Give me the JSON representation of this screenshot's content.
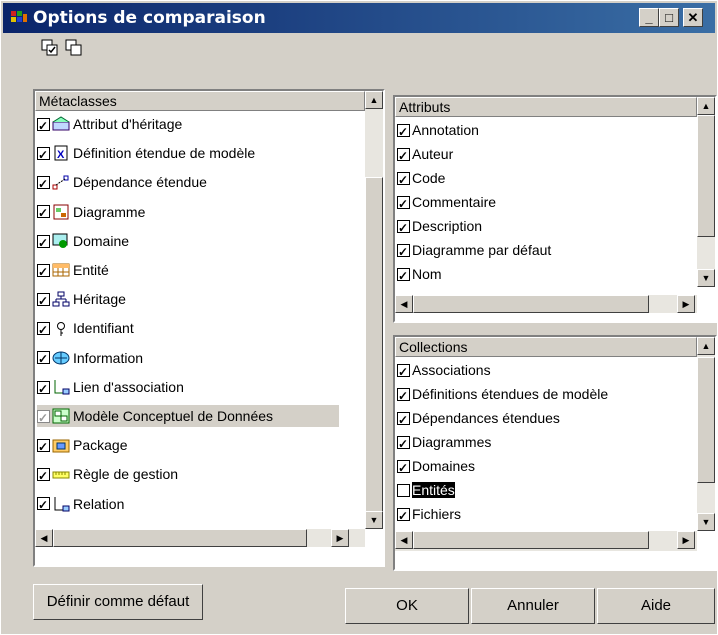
{
  "window": {
    "title": "Options de comparaison",
    "minimize": "_",
    "maximize": "□",
    "close": "✕"
  },
  "toolbar": {
    "icons": [
      "select-all-icon",
      "deselect-all-icon"
    ]
  },
  "metaclasses": {
    "header": "Métaclasses",
    "items": [
      {
        "label": "Attribut d'héritage",
        "checked": true,
        "icon": "inheritance-attribute-icon"
      },
      {
        "label": "Définition étendue de modèle",
        "checked": true,
        "icon": "extended-model-definition-icon"
      },
      {
        "label": "Dépendance étendue",
        "checked": true,
        "icon": "extended-dependency-icon"
      },
      {
        "label": "Diagramme",
        "checked": true,
        "icon": "diagram-icon"
      },
      {
        "label": "Domaine",
        "checked": true,
        "icon": "domain-icon"
      },
      {
        "label": "Entité",
        "checked": true,
        "icon": "entity-icon"
      },
      {
        "label": "Héritage",
        "checked": true,
        "icon": "inheritance-icon"
      },
      {
        "label": "Identifiant",
        "checked": true,
        "icon": "identifier-icon"
      },
      {
        "label": "Information",
        "checked": true,
        "icon": "information-icon"
      },
      {
        "label": "Lien d'association",
        "checked": true,
        "icon": "association-link-icon"
      },
      {
        "label": "Modèle Conceptuel de Données",
        "checked": true,
        "icon": "conceptual-data-model-icon",
        "selected": true
      },
      {
        "label": "Package",
        "checked": true,
        "icon": "package-icon"
      },
      {
        "label": "Règle de gestion",
        "checked": true,
        "icon": "business-rule-icon"
      },
      {
        "label": "Relation",
        "checked": true,
        "icon": "relationship-icon"
      }
    ]
  },
  "attributs": {
    "header": "Attributs",
    "items": [
      {
        "label": "Annotation",
        "checked": true
      },
      {
        "label": "Auteur",
        "checked": true
      },
      {
        "label": "Code",
        "checked": true
      },
      {
        "label": "Commentaire",
        "checked": true
      },
      {
        "label": "Description",
        "checked": true
      },
      {
        "label": "Diagramme par défaut",
        "checked": true
      },
      {
        "label": "Nom",
        "checked": true
      }
    ]
  },
  "collections": {
    "header": "Collections",
    "items": [
      {
        "label": "Associations",
        "checked": true
      },
      {
        "label": "Définitions étendues de modèle",
        "checked": true
      },
      {
        "label": "Dépendances étendues",
        "checked": true
      },
      {
        "label": "Diagrammes",
        "checked": true
      },
      {
        "label": "Domaines",
        "checked": true
      },
      {
        "label": "Entités",
        "checked": false,
        "focused": true
      },
      {
        "label": "Fichiers",
        "checked": true
      }
    ]
  },
  "buttons": {
    "default": "Définir comme défaut",
    "ok": "OK",
    "cancel": "Annuler",
    "help": "Aide"
  }
}
